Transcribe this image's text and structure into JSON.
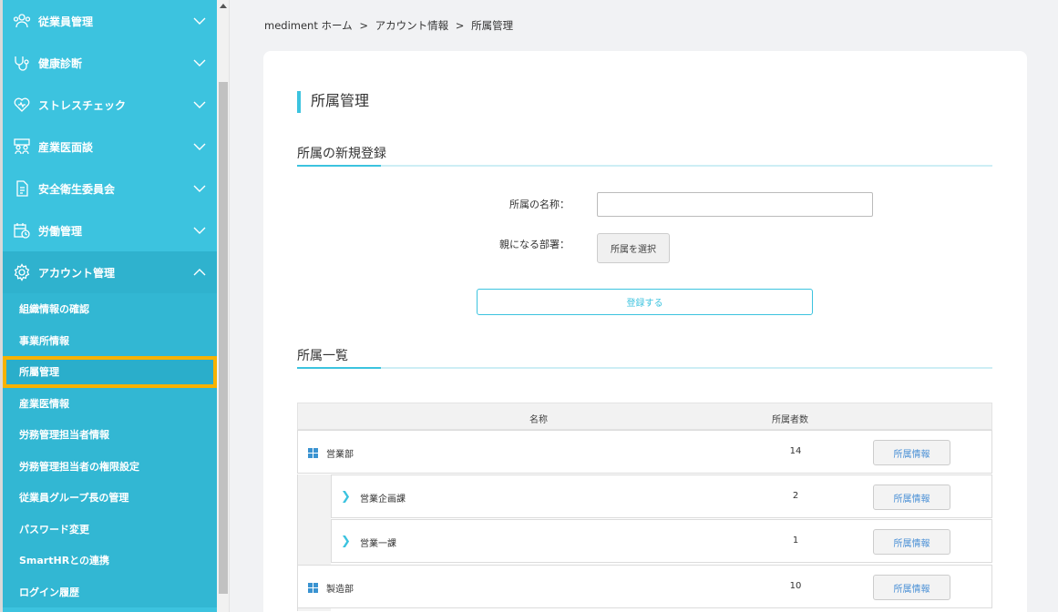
{
  "sidebar": {
    "menu": [
      {
        "label": "従業員管理",
        "icon": "users-icon"
      },
      {
        "label": "健康診断",
        "icon": "stethoscope-icon"
      },
      {
        "label": "ストレスチェック",
        "icon": "heart-icon"
      },
      {
        "label": "産業医面談",
        "icon": "interview-icon"
      },
      {
        "label": "安全衛生委員会",
        "icon": "document-icon"
      },
      {
        "label": "労働管理",
        "icon": "calendar-clock-icon"
      },
      {
        "label": "アカウント管理",
        "icon": "gear-icon"
      }
    ],
    "submenu": [
      "組織情報の確認",
      "事業所情報",
      "所屬管理",
      "産業医情報",
      "労務管理担当者情報",
      "労務管理担当者の権限設定",
      "従業員グループ長の管理",
      "パスワード変更",
      "SmartHRとの連携",
      "ログイン履歴"
    ],
    "active_index": 2,
    "highlight_color": "#f6b200",
    "bg_color": "#3cc3df"
  },
  "breadcrumb": {
    "items": [
      "mediment ホーム",
      ">",
      "アカウント情報",
      ">",
      "所属管理"
    ]
  },
  "page": {
    "title": "所属管理",
    "register_section": "所属の新規登録",
    "name_label": "所属の名称：",
    "name_value": "",
    "parent_label": "親になる部署：",
    "select_parent_label": "所属を選択",
    "register_button": "登録する",
    "list_section": "所属一覧"
  },
  "table": {
    "headers": {
      "name": "名称",
      "count": "所属者数"
    },
    "rows": [
      {
        "name": "営業部",
        "count": "14",
        "button": "所属情報",
        "level": 0
      },
      {
        "name": "営業企画課",
        "count": "2",
        "button": "所属情報",
        "level": 1
      },
      {
        "name": "営業一課",
        "count": "1",
        "button": "所属情報",
        "level": 1
      },
      {
        "name": "製造部",
        "count": "10",
        "button": "所属情報",
        "level": 0
      }
    ]
  }
}
